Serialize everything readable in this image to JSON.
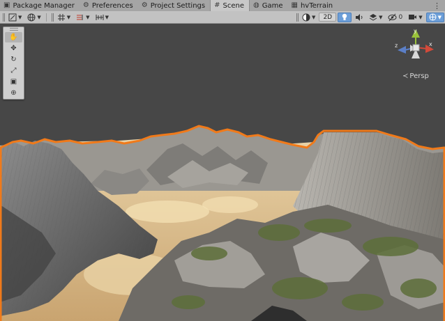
{
  "tabs": [
    {
      "label": "Package Manager",
      "icon": "package-icon"
    },
    {
      "label": "Preferences",
      "icon": "gear-icon"
    },
    {
      "label": "Project Settings",
      "icon": "gear-icon"
    },
    {
      "label": "Scene",
      "icon": "grid-icon",
      "active": true
    },
    {
      "label": "Game",
      "icon": "gamepad-icon"
    },
    {
      "label": "hvTerrain",
      "icon": "hvterrain-icon"
    }
  ],
  "toolbar": {
    "mode_2d": "2D"
  },
  "tools": [
    {
      "name": "hand-tool",
      "glyph": "✋",
      "selected": true
    },
    {
      "name": "move-tool",
      "glyph": "✥"
    },
    {
      "name": "rotate-tool",
      "glyph": "↻"
    },
    {
      "name": "scale-tool",
      "glyph": "⤢"
    },
    {
      "name": "rect-tool",
      "glyph": "▣"
    },
    {
      "name": "transform-tool",
      "glyph": "⊕"
    }
  ],
  "gizmo": {
    "y_label": "y",
    "z_label": "z",
    "x_label": "x"
  },
  "projection": "Persp",
  "colors": {
    "selection_outline": "#f07a1a",
    "scene_background": "#474747",
    "active_button": "#6c9ed8"
  }
}
